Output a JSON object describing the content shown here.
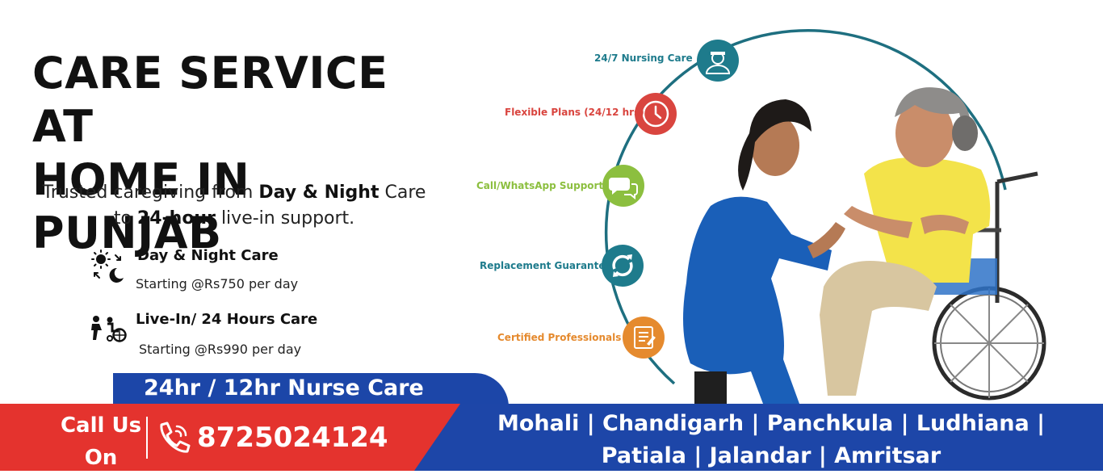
{
  "headline": {
    "line1": "CARE SERVICE AT",
    "line2": "HOME IN PUNJAB"
  },
  "tagline": {
    "part1": "Trusted caregiving from ",
    "bold1": "Day & Night",
    "part2": " Care",
    "part3": "to ",
    "bold2": "24-hour",
    "part4": " live-in support."
  },
  "plans": [
    {
      "title": "Day & Night Care",
      "price": "Starting @Rs750 per day",
      "icon": "day-night-icon"
    },
    {
      "title": "Live-In/ 24 Hours Care",
      "price": "Starting @Rs990 per day",
      "icon": "wheelchair-care-icon"
    }
  ],
  "nurse_banner": "24hr / 12hr Nurse Care",
  "contact": {
    "label_line1": "Call Us",
    "label_line2": "On",
    "phone": "8725024124",
    "icon": "phone-icon"
  },
  "cities": {
    "line1": "Mohali | Chandigarh | Panchkula | Ludhiana |",
    "line2": "Patiala | Jalandar | Amritsar"
  },
  "features": [
    {
      "label": "24/7 Nursing Care",
      "color": "#1e7b8c",
      "icon": "nurse-icon"
    },
    {
      "label": "Flexible Plans (24/12 hrs)",
      "color": "#d9453f",
      "icon": "clock-icon"
    },
    {
      "label": "Call/WhatsApp Support",
      "color": "#8cbf3f",
      "icon": "chat-icon"
    },
    {
      "label": "Replacement Guarantee",
      "color": "#1e7b8c",
      "icon": "refresh-icon"
    },
    {
      "label": "Certified Professionals",
      "color": "#e58a2e",
      "icon": "certificate-icon"
    }
  ],
  "colors": {
    "brand_blue": "#1d46a8",
    "brand_red": "#e4332e",
    "arc": "#1e6f80"
  }
}
